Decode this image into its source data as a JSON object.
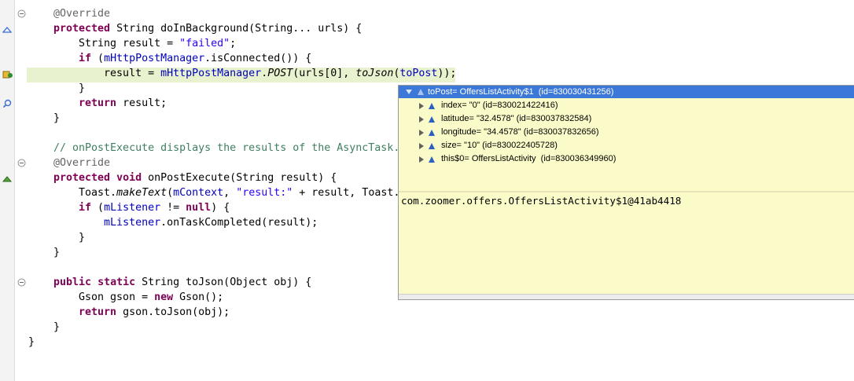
{
  "code": {
    "lines": {
      "l1": [
        "@Override"
      ],
      "l2": [
        "protected",
        " String doInBackground(String... urls) {"
      ],
      "l3": [
        "    String result = ",
        "\"failed\"",
        ";"
      ],
      "l4": [
        "    ",
        "if",
        " (",
        "mHttpPostManager",
        ".isConnected()) {"
      ],
      "l5": [
        "        result = ",
        "mHttpPostManager",
        ".",
        "POST",
        "(urls[0], ",
        "toJson",
        "(",
        "toPost",
        "));"
      ],
      "l6": [
        "    }"
      ],
      "l7": [
        "    ",
        "return",
        " result;"
      ],
      "l8": [
        "}"
      ],
      "l10": [
        "// onPostExecute displays the results of the AsyncTask."
      ],
      "l11": [
        "@Override"
      ],
      "l12": [
        "protected",
        " ",
        "void",
        " onPostExecute(String result) {"
      ],
      "l13": [
        "    Toast.",
        "makeText",
        "(",
        "mContext",
        ", ",
        "\"result:\"",
        " + result, Toast."
      ],
      "l14": [
        "    ",
        "if",
        " (",
        "mListener",
        " != ",
        "null",
        ") {"
      ],
      "l15": [
        "        ",
        "mListener",
        ".onTaskCompleted(result);"
      ],
      "l16": [
        "    }"
      ],
      "l17": [
        "}"
      ],
      "l19": [
        "public",
        " ",
        "static",
        " String toJson(Object obj) {"
      ],
      "l20": [
        "    Gson gson = ",
        "new",
        " Gson();"
      ],
      "l21": [
        "    ",
        "return",
        " gson.toJson(obj);"
      ],
      "l22": [
        "}"
      ],
      "l23": [
        "}"
      ]
    }
  },
  "inspector": {
    "root": "toPost= OffersListActivity$1  (id=830030431256)",
    "children": [
      "index= \"0\" (id=830021422416)",
      "latitude= \"32.4578\" (id=830037832584)",
      "longitude= \"34.4578\" (id=830037832656)",
      "size= \"10\" (id=830022405728)",
      "this$0= OffersListActivity  (id=830036349960)"
    ],
    "detail": "com.zoomer.offers.OffersListActivity$1@41ab4418",
    "colors": {
      "selection": "#3c78d8",
      "background": "#fbfbc9"
    }
  },
  "editor_colors": {
    "keyword": "#7f0055",
    "string": "#2a00ff",
    "field": "#0000c0",
    "comment": "#3f7f5f",
    "current_line": "#e8f2cf"
  }
}
